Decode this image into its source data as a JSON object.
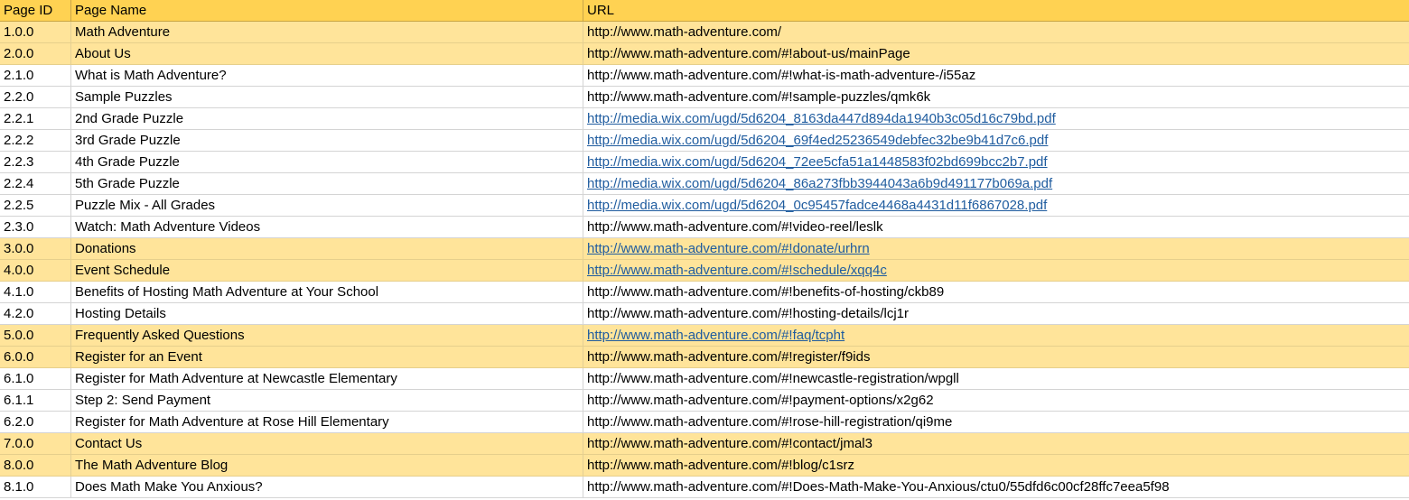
{
  "header": {
    "page_id": "Page ID",
    "page_name": "Page Name",
    "url": "URL"
  },
  "rows": [
    {
      "id": "1.0.0",
      "name": "Math Adventure",
      "url": "http://www.math-adventure.com/"
    },
    {
      "id": "2.0.0",
      "name": "About Us",
      "url": "http://www.math-adventure.com/#!about-us/mainPage"
    },
    {
      "id": "2.1.0",
      "name": "What is Math Adventure?",
      "url": "http://www.math-adventure.com/#!what-is-math-adventure-/i55az"
    },
    {
      "id": "2.2.0",
      "name": "Sample Puzzles",
      "url": "http://www.math-adventure.com/#!sample-puzzles/qmk6k"
    },
    {
      "id": "2.2.1",
      "name": "2nd Grade Puzzle",
      "url": "http://media.wix.com/ugd/5d6204_8163da447d894da1940b3c05d16c79bd.pdf"
    },
    {
      "id": "2.2.2",
      "name": "3rd Grade Puzzle",
      "url": "http://media.wix.com/ugd/5d6204_69f4ed25236549debfec32be9b41d7c6.pdf"
    },
    {
      "id": "2.2.3",
      "name": "4th Grade Puzzle",
      "url": "http://media.wix.com/ugd/5d6204_72ee5cfa51a1448583f02bd699bcc2b7.pdf"
    },
    {
      "id": "2.2.4",
      "name": "5th Grade Puzzle",
      "url": "http://media.wix.com/ugd/5d6204_86a273fbb3944043a6b9d491177b069a.pdf"
    },
    {
      "id": "2.2.5",
      "name": "Puzzle Mix - All Grades",
      "url": "http://media.wix.com/ugd/5d6204_0c95457fadce4468a4431d11f6867028.pdf"
    },
    {
      "id": "2.3.0",
      "name": "Watch: Math Adventure Videos",
      "url": "http://www.math-adventure.com/#!video-reel/leslk"
    },
    {
      "id": "3.0.0",
      "name": "Donations",
      "url": "http://www.math-adventure.com/#!donate/urhrn"
    },
    {
      "id": "4.0.0",
      "name": "Event Schedule",
      "url": "http://www.math-adventure.com/#!schedule/xqq4c"
    },
    {
      "id": "4.1.0",
      "name": "Benefits of Hosting Math Adventure at Your School",
      "url": "http://www.math-adventure.com/#!benefits-of-hosting/ckb89"
    },
    {
      "id": "4.2.0",
      "name": "Hosting Details",
      "url": "http://www.math-adventure.com/#!hosting-details/lcj1r"
    },
    {
      "id": "5.0.0",
      "name": "Frequently Asked Questions",
      "url": "http://www.math-adventure.com/#!faq/tcpht"
    },
    {
      "id": "6.0.0",
      "name": "Register for an Event",
      "url": "http://www.math-adventure.com/#!register/f9ids"
    },
    {
      "id": "6.1.0",
      "name": "Register for Math Adventure at Newcastle Elementary",
      "url": "http://www.math-adventure.com/#!newcastle-registration/wpgll"
    },
    {
      "id": "6.1.1",
      "name": "Step 2: Send Payment",
      "url": "http://www.math-adventure.com/#!payment-options/x2g62"
    },
    {
      "id": "6.2.0",
      "name": "Register for Math Adventure at Rose Hill Elementary",
      "url": "http://www.math-adventure.com/#!rose-hill-registration/qi9me"
    },
    {
      "id": "7.0.0",
      "name": "Contact Us",
      "url": "http://www.math-adventure.com/#!contact/jmal3"
    },
    {
      "id": "8.0.0",
      "name": "The Math Adventure Blog",
      "url": "http://www.math-adventure.com/#!blog/c1srz"
    },
    {
      "id": "8.1.0",
      "name": "Does Math Make You Anxious?",
      "url": "http://www.math-adventure.com/#!Does-Math-Make-You-Anxious/ctu0/55dfd6c00cf28ffc7eea5f98"
    }
  ],
  "colors": {
    "header_fill": "#ffd252",
    "highlight_fill": "#ffe49a",
    "link_color": "#1f5c9f"
  }
}
